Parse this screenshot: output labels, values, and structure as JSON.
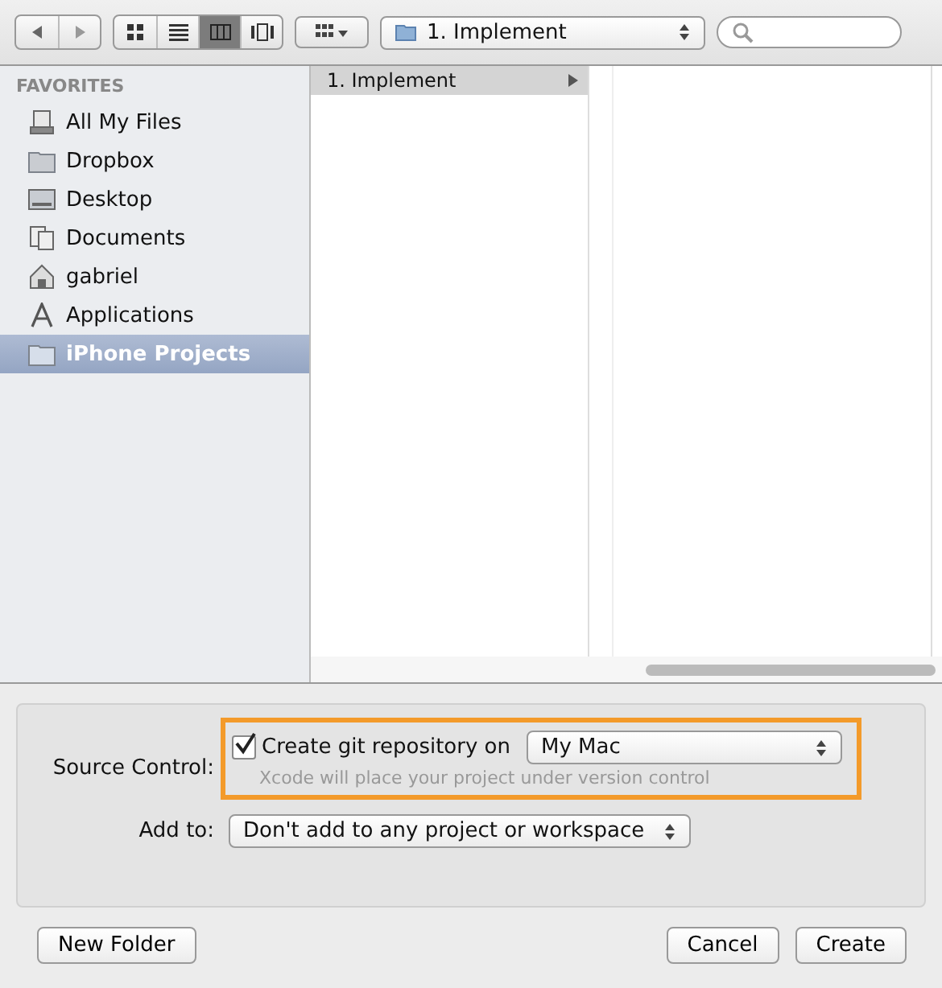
{
  "toolbar": {
    "view_modes": [
      {
        "kind": "icons",
        "selected": false
      },
      {
        "kind": "list",
        "selected": false
      },
      {
        "kind": "columns",
        "selected": true
      },
      {
        "kind": "coverflow",
        "selected": false
      }
    ],
    "path_popup": "1. Implement"
  },
  "sidebar": {
    "heading": "FAVORITES",
    "items": [
      {
        "label": "All My Files",
        "kind": "allfiles",
        "selected": false
      },
      {
        "label": "Dropbox",
        "kind": "folder",
        "selected": false
      },
      {
        "label": "Desktop",
        "kind": "desktop",
        "selected": false
      },
      {
        "label": "Documents",
        "kind": "documents",
        "selected": false
      },
      {
        "label": "gabriel",
        "kind": "home",
        "selected": false
      },
      {
        "label": "Applications",
        "kind": "apps",
        "selected": false
      },
      {
        "label": "iPhone Projects",
        "kind": "folder",
        "selected": true
      }
    ]
  },
  "browser": {
    "column_1": [
      {
        "label": "1. Implement",
        "selected": true
      }
    ]
  },
  "options": {
    "source_control": {
      "label": "Source Control:",
      "checkbox": "Create git repository on",
      "checked": true,
      "location": "My Mac",
      "hint": "Xcode will place your project under version control"
    },
    "add_to": {
      "label": "Add to:",
      "value": "Don't add to any project or workspace"
    }
  },
  "buttons": {
    "new_folder": "New Folder",
    "cancel": "Cancel",
    "create": "Create"
  }
}
